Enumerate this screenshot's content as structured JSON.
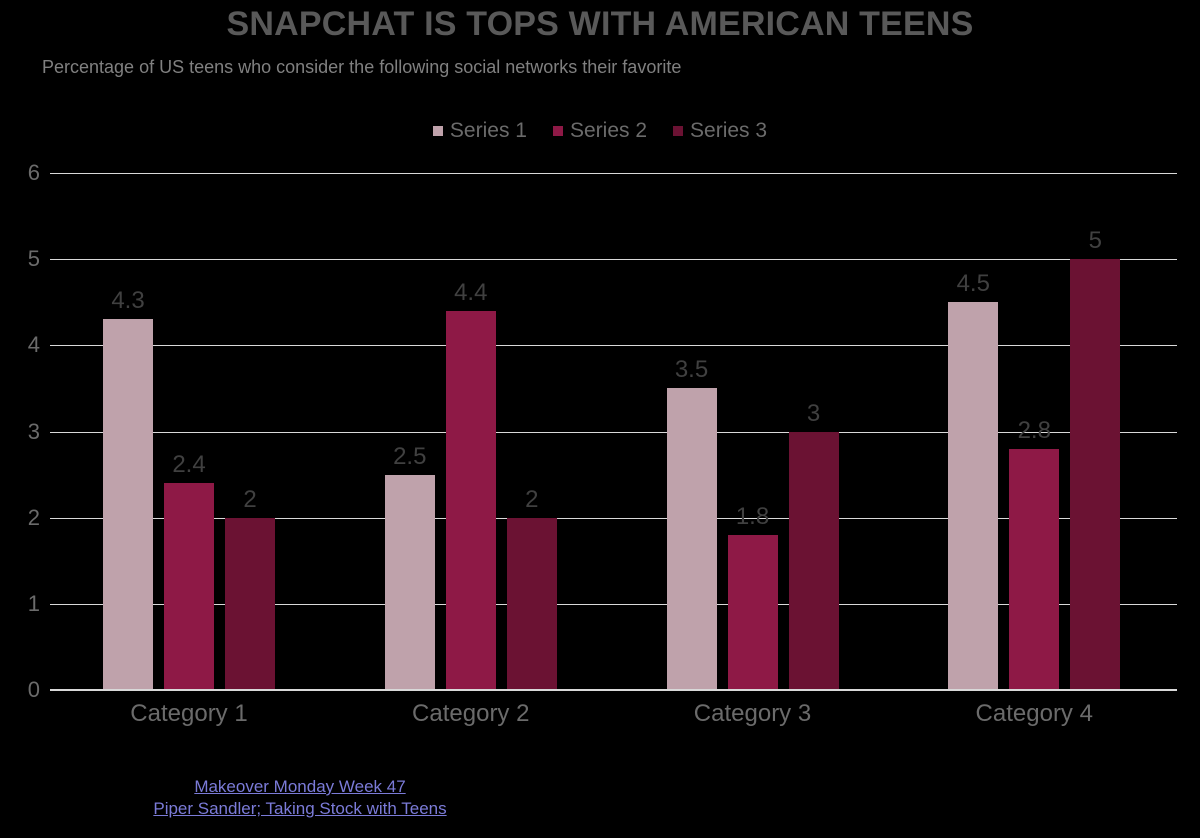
{
  "chart_data": {
    "type": "bar",
    "title": "SNAPCHAT IS TOPS WITH AMERICAN TEENS",
    "subtitle": "Percentage of US teens who consider the following social networks their favorite",
    "xlabel": "",
    "ylabel": "",
    "ylim": [
      0,
      6
    ],
    "yticks": [
      6,
      5,
      4,
      3,
      2,
      1,
      0
    ],
    "ytick_labels": [
      "6",
      "5",
      "4",
      "3",
      "2",
      "1",
      "0"
    ],
    "grid": true,
    "grid_axis": "y",
    "legend_position": "top-center",
    "background": "#000000",
    "categories": [
      "Category 1",
      "Category 2",
      "Category 3",
      "Category 4"
    ],
    "series": [
      {
        "name": "Series 1",
        "color": "#bfa2ab",
        "values": [
          4.3,
          2.5,
          3.5,
          4.5
        ],
        "labels": [
          "4.3",
          "2.5",
          "3.5",
          "4.5"
        ]
      },
      {
        "name": "Series 2",
        "color": "#8e1946",
        "values": [
          2.4,
          4.4,
          1.8,
          2.8
        ],
        "labels": [
          "2.4",
          "4.4",
          "1.8",
          "2.8"
        ]
      },
      {
        "name": "Series 3",
        "color": "#6b1233",
        "values": [
          2,
          2,
          3,
          5
        ],
        "labels": [
          "2",
          "2",
          "3",
          "5"
        ]
      }
    ]
  },
  "footer": {
    "links": [
      {
        "label": "Makeover Monday Week 47"
      },
      {
        "label": "Piper Sandler; Taking Stock with Teens"
      }
    ]
  },
  "colors": {
    "background": "#000000",
    "title": "#595959",
    "subtitle": "#808080",
    "tick": "#6b6b6b",
    "data_label": "#404040",
    "gridline": "#d9d9d9",
    "link": "#7b7bd8",
    "series_1": "#bfa2ab",
    "series_2": "#8e1946",
    "series_3": "#6b1233"
  }
}
